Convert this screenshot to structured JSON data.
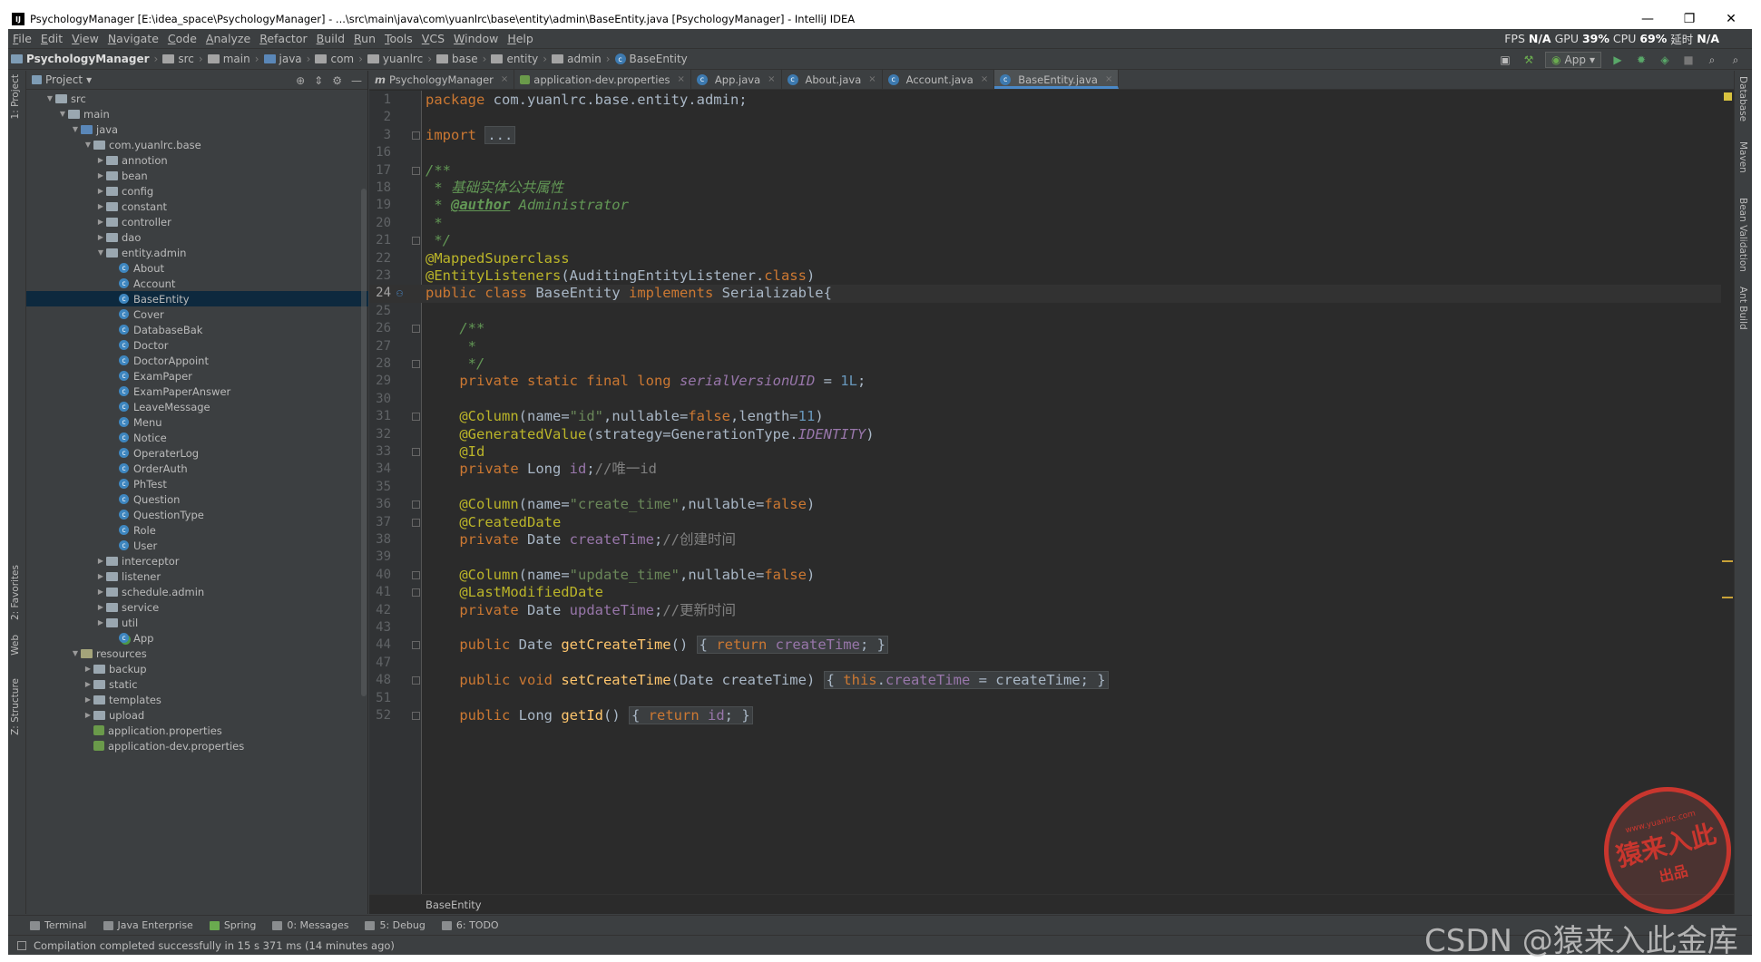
{
  "window": {
    "title": "PsychologyManager [E:\\idea_space\\PsychologyManager] - ...\\src\\main\\java\\com\\yuanlrc\\base\\entity\\admin\\BaseEntity.java [PsychologyManager] - IntelliJ IDEA",
    "minimize": "—",
    "restore": "❐",
    "close": "✕"
  },
  "menu": [
    "File",
    "Edit",
    "View",
    "Navigate",
    "Code",
    "Analyze",
    "Refactor",
    "Build",
    "Run",
    "Tools",
    "VCS",
    "Window",
    "Help"
  ],
  "perf": {
    "fps_label": "FPS",
    "fps_value": "N/A",
    "gpu_label": "GPU",
    "gpu_value": "39",
    "gpu_unit": "%",
    "cpu_label": "CPU",
    "cpu_value": "69",
    "cpu_unit": "%",
    "lat_label": "延时",
    "lat_value": "N/A"
  },
  "breadcrumbs": [
    "PsychologyManager",
    "src",
    "main",
    "java",
    "com",
    "yuanlrc",
    "base",
    "entity",
    "admin",
    "BaseEntity"
  ],
  "run_config": "App",
  "project_panel": {
    "title": "Project",
    "tree": [
      {
        "label": "src",
        "level": 1,
        "arrow": "▼",
        "icon": "folder"
      },
      {
        "label": "main",
        "level": 2,
        "arrow": "▼",
        "icon": "folder"
      },
      {
        "label": "java",
        "level": 3,
        "arrow": "▼",
        "icon": "src"
      },
      {
        "label": "com.yuanlrc.base",
        "level": 4,
        "arrow": "▼",
        "icon": "pkg"
      },
      {
        "label": "annotion",
        "level": 5,
        "arrow": "▶",
        "icon": "pkg"
      },
      {
        "label": "bean",
        "level": 5,
        "arrow": "▶",
        "icon": "pkg"
      },
      {
        "label": "config",
        "level": 5,
        "arrow": "▶",
        "icon": "pkg"
      },
      {
        "label": "constant",
        "level": 5,
        "arrow": "▶",
        "icon": "pkg"
      },
      {
        "label": "controller",
        "level": 5,
        "arrow": "▶",
        "icon": "pkg"
      },
      {
        "label": "dao",
        "level": 5,
        "arrow": "▶",
        "icon": "pkg"
      },
      {
        "label": "entity.admin",
        "level": 5,
        "arrow": "▼",
        "icon": "pkg"
      },
      {
        "label": "About",
        "level": 6,
        "arrow": "",
        "icon": "class"
      },
      {
        "label": "Account",
        "level": 6,
        "arrow": "",
        "icon": "class"
      },
      {
        "label": "BaseEntity",
        "level": 6,
        "arrow": "",
        "icon": "class",
        "selected": true
      },
      {
        "label": "Cover",
        "level": 6,
        "arrow": "",
        "icon": "class"
      },
      {
        "label": "DatabaseBak",
        "level": 6,
        "arrow": "",
        "icon": "class"
      },
      {
        "label": "Doctor",
        "level": 6,
        "arrow": "",
        "icon": "class"
      },
      {
        "label": "DoctorAppoint",
        "level": 6,
        "arrow": "",
        "icon": "class"
      },
      {
        "label": "ExamPaper",
        "level": 6,
        "arrow": "",
        "icon": "class"
      },
      {
        "label": "ExamPaperAnswer",
        "level": 6,
        "arrow": "",
        "icon": "class"
      },
      {
        "label": "LeaveMessage",
        "level": 6,
        "arrow": "",
        "icon": "class"
      },
      {
        "label": "Menu",
        "level": 6,
        "arrow": "",
        "icon": "class"
      },
      {
        "label": "Notice",
        "level": 6,
        "arrow": "",
        "icon": "class"
      },
      {
        "label": "OperaterLog",
        "level": 6,
        "arrow": "",
        "icon": "class"
      },
      {
        "label": "OrderAuth",
        "level": 6,
        "arrow": "",
        "icon": "class"
      },
      {
        "label": "PhTest",
        "level": 6,
        "arrow": "",
        "icon": "class"
      },
      {
        "label": "Question",
        "level": 6,
        "arrow": "",
        "icon": "class"
      },
      {
        "label": "QuestionType",
        "level": 6,
        "arrow": "",
        "icon": "class"
      },
      {
        "label": "Role",
        "level": 6,
        "arrow": "",
        "icon": "class"
      },
      {
        "label": "User",
        "level": 6,
        "arrow": "",
        "icon": "class"
      },
      {
        "label": "interceptor",
        "level": 5,
        "arrow": "▶",
        "icon": "pkg"
      },
      {
        "label": "listener",
        "level": 5,
        "arrow": "▶",
        "icon": "pkg"
      },
      {
        "label": "schedule.admin",
        "level": 5,
        "arrow": "▶",
        "icon": "pkg"
      },
      {
        "label": "service",
        "level": 5,
        "arrow": "▶",
        "icon": "pkg"
      },
      {
        "label": "util",
        "level": 5,
        "arrow": "▶",
        "icon": "pkg"
      },
      {
        "label": "App",
        "level": 6,
        "arrow": "",
        "icon": "app"
      },
      {
        "label": "resources",
        "level": 3,
        "arrow": "▼",
        "icon": "res"
      },
      {
        "label": "backup",
        "level": 4,
        "arrow": "▶",
        "icon": "folder"
      },
      {
        "label": "static",
        "level": 4,
        "arrow": "▶",
        "icon": "folder"
      },
      {
        "label": "templates",
        "level": 4,
        "arrow": "▶",
        "icon": "folder"
      },
      {
        "label": "upload",
        "level": 4,
        "arrow": "▶",
        "icon": "folder"
      },
      {
        "label": "application.properties",
        "level": 4,
        "arrow": "",
        "icon": "prop"
      },
      {
        "label": "application-dev.properties",
        "level": 4,
        "arrow": "",
        "icon": "prop"
      }
    ]
  },
  "left_tabs": [
    "1: Project",
    "2: Favorites",
    "Web",
    "Z: Structure"
  ],
  "right_tabs": [
    "Database",
    "Maven",
    "Bean Validation",
    "Ant Build"
  ],
  "editor_tabs": [
    {
      "label": "PsychologyManager",
      "icon": "m"
    },
    {
      "label": "application-dev.properties",
      "icon": "prop"
    },
    {
      "label": "App.java",
      "icon": "class"
    },
    {
      "label": "About.java",
      "icon": "class"
    },
    {
      "label": "Account.java",
      "icon": "class"
    },
    {
      "label": "BaseEntity.java",
      "icon": "class",
      "active": true
    }
  ],
  "code_lines": [
    {
      "n": "1",
      "html": "<span class='kw'>package </span>com.yuanlrc.base.entity.admin;"
    },
    {
      "n": "2",
      "html": ""
    },
    {
      "n": "3",
      "html": "<span class='kw'>import </span><span class='fold-box'>...</span>",
      "fold": true
    },
    {
      "n": "16",
      "html": ""
    },
    {
      "n": "17",
      "html": "<span class='doc'>/**</span>",
      "fold": true
    },
    {
      "n": "18",
      "html": "<span class='doc'> * 基础实体公共属性</span>"
    },
    {
      "n": "19",
      "html": "<span class='doc'> * </span><span class='doctag'>@author</span><span class='doc'> Administrator</span>"
    },
    {
      "n": "20",
      "html": "<span class='doc'> *</span>"
    },
    {
      "n": "21",
      "html": "<span class='doc'> */</span>",
      "fold": true
    },
    {
      "n": "22",
      "html": "<span class='ann'>@MappedSuperclass</span>"
    },
    {
      "n": "23",
      "html": "<span class='ann'>@EntityListeners</span>(AuditingEntityListener.<span class='kw'>class</span>)"
    },
    {
      "n": "24",
      "html": "<span class='kw'>public class </span>BaseEntity <span class='kw'>implements </span>Serializable{",
      "cur": true
    },
    {
      "n": "25",
      "html": ""
    },
    {
      "n": "26",
      "html": "    <span class='doc'>/**</span>",
      "fold": true
    },
    {
      "n": "27",
      "html": "    <span class='doc'> *</span>"
    },
    {
      "n": "28",
      "html": "    <span class='doc'> */</span>",
      "fold": true
    },
    {
      "n": "29",
      "html": "    <span class='kw'>private static final long </span><span class='sfld'>serialVersionUID</span> = <span class='num'>1L</span>;"
    },
    {
      "n": "30",
      "html": ""
    },
    {
      "n": "31",
      "html": "    <span class='ann'>@Column</span>(name=<span class='str'>\"id\"</span>,nullable=<span class='kw'>false</span>,length=<span class='num'>11</span>)",
      "fold": true
    },
    {
      "n": "32",
      "html": "    <span class='ann'>@GeneratedValue</span>(strategy=GenerationType.<span class='sfld'>IDENTITY</span>)"
    },
    {
      "n": "33",
      "html": "    <span class='ann'>@Id</span>",
      "fold": true
    },
    {
      "n": "34",
      "html": "    <span class='kw'>private </span>Long <span class='fld'>id</span>;<span class='cm'>//唯一id</span>"
    },
    {
      "n": "35",
      "html": ""
    },
    {
      "n": "36",
      "html": "    <span class='ann'>@Column</span>(name=<span class='str'>\"create_time\"</span>,nullable=<span class='kw'>false</span>)",
      "fold": true
    },
    {
      "n": "37",
      "html": "    <span class='ann'>@CreatedDate</span>",
      "fold": true
    },
    {
      "n": "38",
      "html": "    <span class='kw'>private </span>Date <span class='fld'>createTime</span>;<span class='cm'>//创建时间</span>"
    },
    {
      "n": "39",
      "html": ""
    },
    {
      "n": "40",
      "html": "    <span class='ann'>@Column</span>(name=<span class='str'>\"update_time\"</span>,nullable=<span class='kw'>false</span>)",
      "fold": true
    },
    {
      "n": "41",
      "html": "    <span class='ann'>@LastModifiedDate</span>",
      "fold": true
    },
    {
      "n": "42",
      "html": "    <span class='kw'>private </span>Date <span class='fld'>updateTime</span>;<span class='cm'>//更新时间</span>"
    },
    {
      "n": "43",
      "html": ""
    },
    {
      "n": "44",
      "html": "    <span class='kw'>public </span>Date <span class='mth'>getCreateTime</span>() <span class='fold-box'>{ <span class='kw'>return </span><span class='fld'>createTime</span>; }</span>",
      "fold": true
    },
    {
      "n": "47",
      "html": ""
    },
    {
      "n": "48",
      "html": "    <span class='kw'>public void </span><span class='mth'>setCreateTime</span>(Date createTime) <span class='fold-box'>{ <span class='kw'>this</span>.<span class='fld'>createTime</span> = createTime; }</span>",
      "fold": true
    },
    {
      "n": "51",
      "html": ""
    },
    {
      "n": "52",
      "html": "    <span class='kw'>public </span>Long <span class='mth'>getId</span>() <span class='fold-box'>{ <span class='kw'>return </span><span class='fld'>id</span>; }</span>",
      "fold": true
    }
  ],
  "editor_breadcrumb": "BaseEntity",
  "bottom_tools": [
    {
      "label": "Terminal"
    },
    {
      "label": "Java Enterprise"
    },
    {
      "label": "Spring"
    },
    {
      "label": "0: Messages"
    },
    {
      "label": "5: Debug"
    },
    {
      "label": "6: TODO"
    }
  ],
  "status": "Compilation completed successfully in 15 s 371 ms (14 minutes ago)",
  "watermark": {
    "stamp_url": "www.yuanlrc.com",
    "stamp_main": "猿来入此",
    "stamp_sub": "出品",
    "csdn": "CSDN @猿来入此金库"
  }
}
